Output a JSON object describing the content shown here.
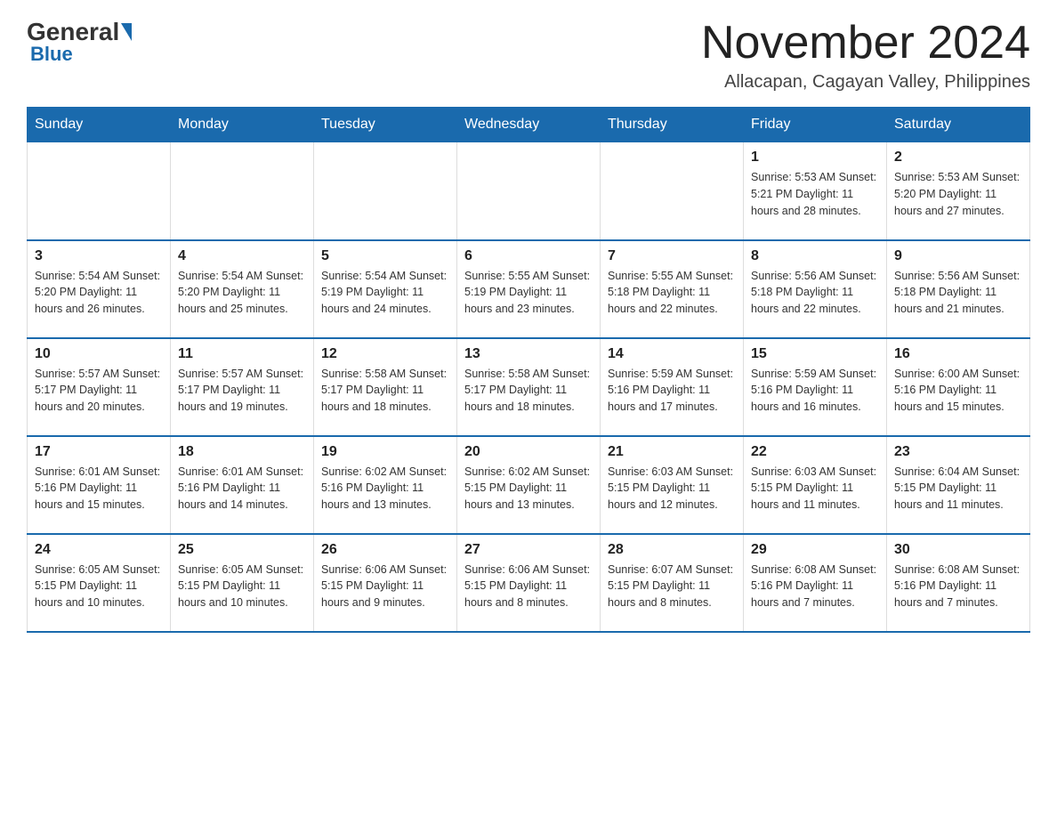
{
  "logo": {
    "general": "General",
    "blue": "Blue"
  },
  "title": "November 2024",
  "location": "Allacapan, Cagayan Valley, Philippines",
  "days_of_week": [
    "Sunday",
    "Monday",
    "Tuesday",
    "Wednesday",
    "Thursday",
    "Friday",
    "Saturday"
  ],
  "weeks": [
    [
      {
        "day": "",
        "info": ""
      },
      {
        "day": "",
        "info": ""
      },
      {
        "day": "",
        "info": ""
      },
      {
        "day": "",
        "info": ""
      },
      {
        "day": "",
        "info": ""
      },
      {
        "day": "1",
        "info": "Sunrise: 5:53 AM\nSunset: 5:21 PM\nDaylight: 11 hours\nand 28 minutes."
      },
      {
        "day": "2",
        "info": "Sunrise: 5:53 AM\nSunset: 5:20 PM\nDaylight: 11 hours\nand 27 minutes."
      }
    ],
    [
      {
        "day": "3",
        "info": "Sunrise: 5:54 AM\nSunset: 5:20 PM\nDaylight: 11 hours\nand 26 minutes."
      },
      {
        "day": "4",
        "info": "Sunrise: 5:54 AM\nSunset: 5:20 PM\nDaylight: 11 hours\nand 25 minutes."
      },
      {
        "day": "5",
        "info": "Sunrise: 5:54 AM\nSunset: 5:19 PM\nDaylight: 11 hours\nand 24 minutes."
      },
      {
        "day": "6",
        "info": "Sunrise: 5:55 AM\nSunset: 5:19 PM\nDaylight: 11 hours\nand 23 minutes."
      },
      {
        "day": "7",
        "info": "Sunrise: 5:55 AM\nSunset: 5:18 PM\nDaylight: 11 hours\nand 22 minutes."
      },
      {
        "day": "8",
        "info": "Sunrise: 5:56 AM\nSunset: 5:18 PM\nDaylight: 11 hours\nand 22 minutes."
      },
      {
        "day": "9",
        "info": "Sunrise: 5:56 AM\nSunset: 5:18 PM\nDaylight: 11 hours\nand 21 minutes."
      }
    ],
    [
      {
        "day": "10",
        "info": "Sunrise: 5:57 AM\nSunset: 5:17 PM\nDaylight: 11 hours\nand 20 minutes."
      },
      {
        "day": "11",
        "info": "Sunrise: 5:57 AM\nSunset: 5:17 PM\nDaylight: 11 hours\nand 19 minutes."
      },
      {
        "day": "12",
        "info": "Sunrise: 5:58 AM\nSunset: 5:17 PM\nDaylight: 11 hours\nand 18 minutes."
      },
      {
        "day": "13",
        "info": "Sunrise: 5:58 AM\nSunset: 5:17 PM\nDaylight: 11 hours\nand 18 minutes."
      },
      {
        "day": "14",
        "info": "Sunrise: 5:59 AM\nSunset: 5:16 PM\nDaylight: 11 hours\nand 17 minutes."
      },
      {
        "day": "15",
        "info": "Sunrise: 5:59 AM\nSunset: 5:16 PM\nDaylight: 11 hours\nand 16 minutes."
      },
      {
        "day": "16",
        "info": "Sunrise: 6:00 AM\nSunset: 5:16 PM\nDaylight: 11 hours\nand 15 minutes."
      }
    ],
    [
      {
        "day": "17",
        "info": "Sunrise: 6:01 AM\nSunset: 5:16 PM\nDaylight: 11 hours\nand 15 minutes."
      },
      {
        "day": "18",
        "info": "Sunrise: 6:01 AM\nSunset: 5:16 PM\nDaylight: 11 hours\nand 14 minutes."
      },
      {
        "day": "19",
        "info": "Sunrise: 6:02 AM\nSunset: 5:16 PM\nDaylight: 11 hours\nand 13 minutes."
      },
      {
        "day": "20",
        "info": "Sunrise: 6:02 AM\nSunset: 5:15 PM\nDaylight: 11 hours\nand 13 minutes."
      },
      {
        "day": "21",
        "info": "Sunrise: 6:03 AM\nSunset: 5:15 PM\nDaylight: 11 hours\nand 12 minutes."
      },
      {
        "day": "22",
        "info": "Sunrise: 6:03 AM\nSunset: 5:15 PM\nDaylight: 11 hours\nand 11 minutes."
      },
      {
        "day": "23",
        "info": "Sunrise: 6:04 AM\nSunset: 5:15 PM\nDaylight: 11 hours\nand 11 minutes."
      }
    ],
    [
      {
        "day": "24",
        "info": "Sunrise: 6:05 AM\nSunset: 5:15 PM\nDaylight: 11 hours\nand 10 minutes."
      },
      {
        "day": "25",
        "info": "Sunrise: 6:05 AM\nSunset: 5:15 PM\nDaylight: 11 hours\nand 10 minutes."
      },
      {
        "day": "26",
        "info": "Sunrise: 6:06 AM\nSunset: 5:15 PM\nDaylight: 11 hours\nand 9 minutes."
      },
      {
        "day": "27",
        "info": "Sunrise: 6:06 AM\nSunset: 5:15 PM\nDaylight: 11 hours\nand 8 minutes."
      },
      {
        "day": "28",
        "info": "Sunrise: 6:07 AM\nSunset: 5:15 PM\nDaylight: 11 hours\nand 8 minutes."
      },
      {
        "day": "29",
        "info": "Sunrise: 6:08 AM\nSunset: 5:16 PM\nDaylight: 11 hours\nand 7 minutes."
      },
      {
        "day": "30",
        "info": "Sunrise: 6:08 AM\nSunset: 5:16 PM\nDaylight: 11 hours\nand 7 minutes."
      }
    ]
  ]
}
